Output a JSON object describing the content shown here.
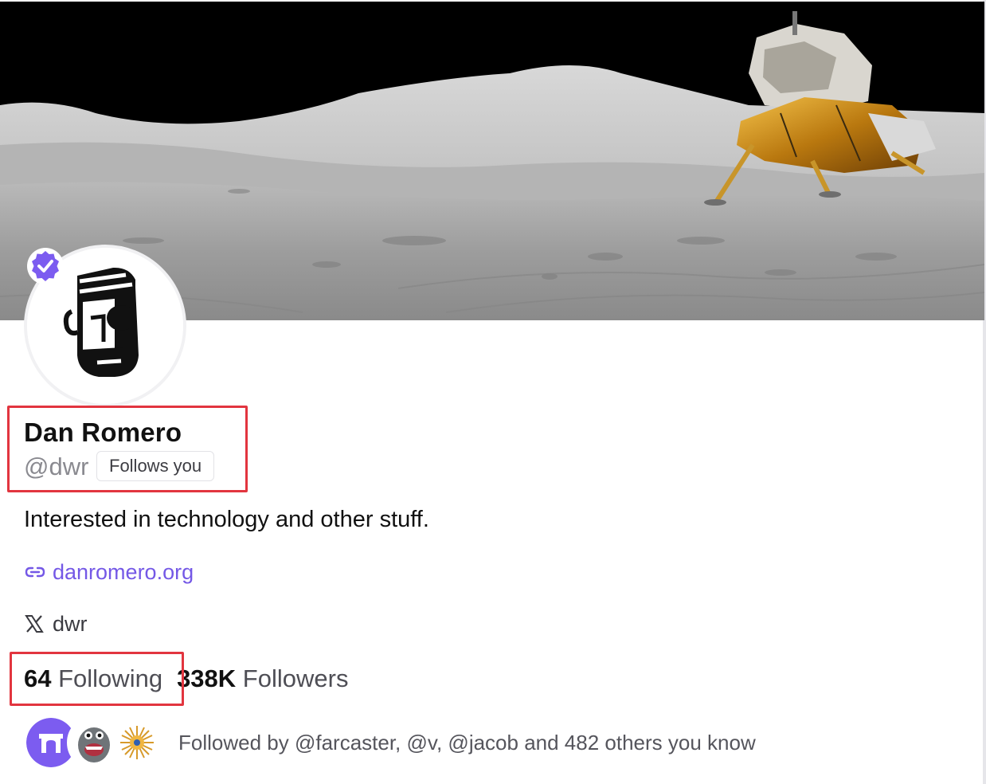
{
  "profile": {
    "display_name": "Dan Romero",
    "username": "@dwr",
    "follows_you_badge": "Follows you",
    "bio": "Interested in technology and other stuff.",
    "website": "danromero.org",
    "x_handle": "dwr"
  },
  "stats": {
    "following_count": "64",
    "following_label": "Following",
    "followers_count": "338K",
    "followers_label": "Followers"
  },
  "mutuals": {
    "text": "Followed by @farcaster, @v, @jacob and 482 others you know",
    "avatars": [
      "farcaster-avatar",
      "monster-avatar",
      "sun-avatar"
    ]
  },
  "colors": {
    "accent": "#7458e6",
    "highlight": "#e2353f",
    "farcaster_purple": "#7c5cf0"
  },
  "icons": [
    "link-icon",
    "x-logo-icon",
    "verified-badge-icon"
  ]
}
